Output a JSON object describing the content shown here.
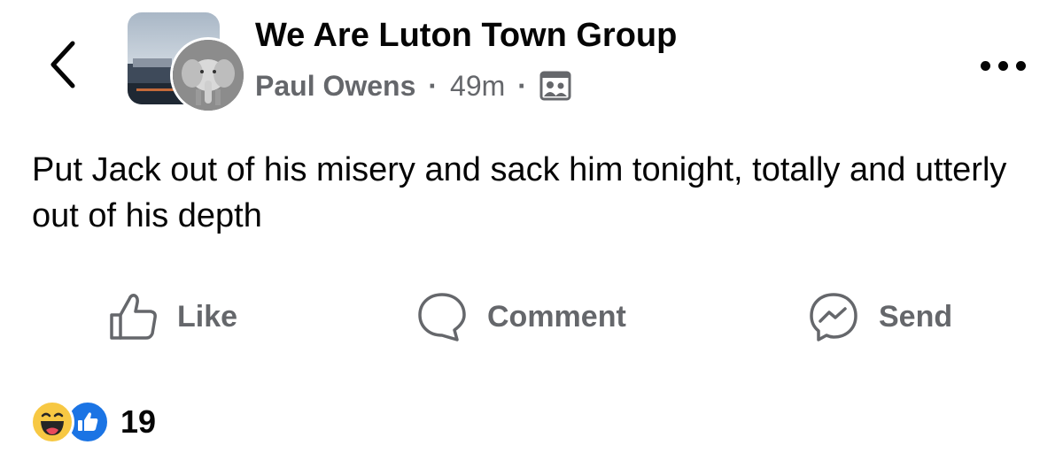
{
  "header": {
    "group_name": "We Are Luton Town Group",
    "author": "Paul Owens",
    "separator": "·",
    "time": "49m",
    "privacy_icon": "members-only-icon"
  },
  "post": {
    "text": "Put Jack out of his misery and sack him tonight, totally and utterly out of his depth"
  },
  "actions": {
    "like_label": "Like",
    "comment_label": "Comment",
    "send_label": "Send"
  },
  "reactions": {
    "types": [
      "haha",
      "like"
    ],
    "count": "19"
  },
  "colors": {
    "primary_text": "#050505",
    "secondary_text": "#65676b",
    "like_blue": "#1b74e4",
    "haha_yellow": "#f7c843"
  }
}
